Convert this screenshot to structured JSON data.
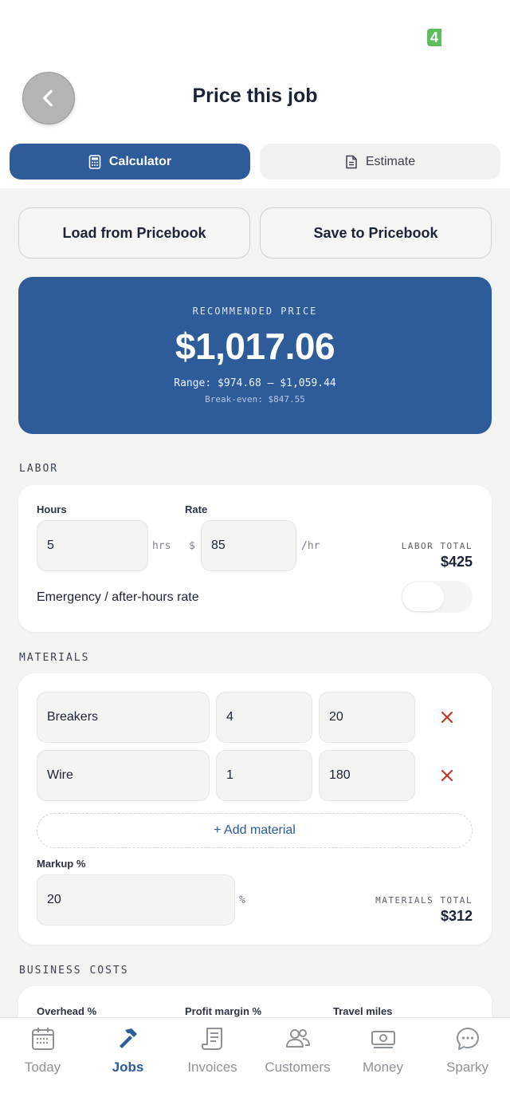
{
  "status": {
    "badge": "4"
  },
  "header": {
    "title": "Price this job"
  },
  "tabs": [
    {
      "label": "Calculator",
      "icon": "calculator-icon",
      "active": true
    },
    {
      "label": "Estimate",
      "icon": "document-icon",
      "active": false
    }
  ],
  "pricebook": {
    "load_label": "Load from Pricebook",
    "save_label": "Save to Pricebook"
  },
  "price": {
    "label": "RECOMMENDED PRICE",
    "amount": "$1,017.06",
    "range": "Range: $974.68 – $1,059.44",
    "break_even": "Break-even: $847.55"
  },
  "labor": {
    "section": "LABOR",
    "hours_label": "Hours",
    "hours_value": "5",
    "hours_unit": "hrs",
    "rate_label": "Rate",
    "rate_prefix": "$",
    "rate_value": "85",
    "rate_unit": "/hr",
    "total_label": "LABOR TOTAL",
    "total_value": "$425",
    "emergency_label": "Emergency / after-hours rate",
    "emergency_on": false
  },
  "materials": {
    "section": "MATERIALS",
    "items": [
      {
        "name": "Breakers",
        "qty": "4",
        "price": "20"
      },
      {
        "name": "Wire",
        "qty": "1",
        "price": "180"
      }
    ],
    "add_label": "+ Add material",
    "markup_label": "Markup %",
    "markup_value": "20",
    "markup_unit": "%",
    "total_label": "MATERIALS TOTAL",
    "total_value": "$312"
  },
  "business": {
    "section": "BUSINESS COSTS",
    "overhead_label": "Overhead %",
    "profit_label": "Profit margin %",
    "travel_label": "Travel miles"
  },
  "nav": [
    {
      "label": "Today",
      "icon": "calendar-icon",
      "active": false
    },
    {
      "label": "Jobs",
      "icon": "hammer-icon",
      "active": true
    },
    {
      "label": "Invoices",
      "icon": "receipt-icon",
      "active": false
    },
    {
      "label": "Customers",
      "icon": "people-icon",
      "active": false
    },
    {
      "label": "Money",
      "icon": "cash-icon",
      "active": false
    },
    {
      "label": "Sparky",
      "icon": "chat-bubble-icon",
      "active": false
    }
  ],
  "colors": {
    "brand": "#2e5b9a",
    "danger": "#c0392b",
    "status": "#5cbf5c"
  }
}
